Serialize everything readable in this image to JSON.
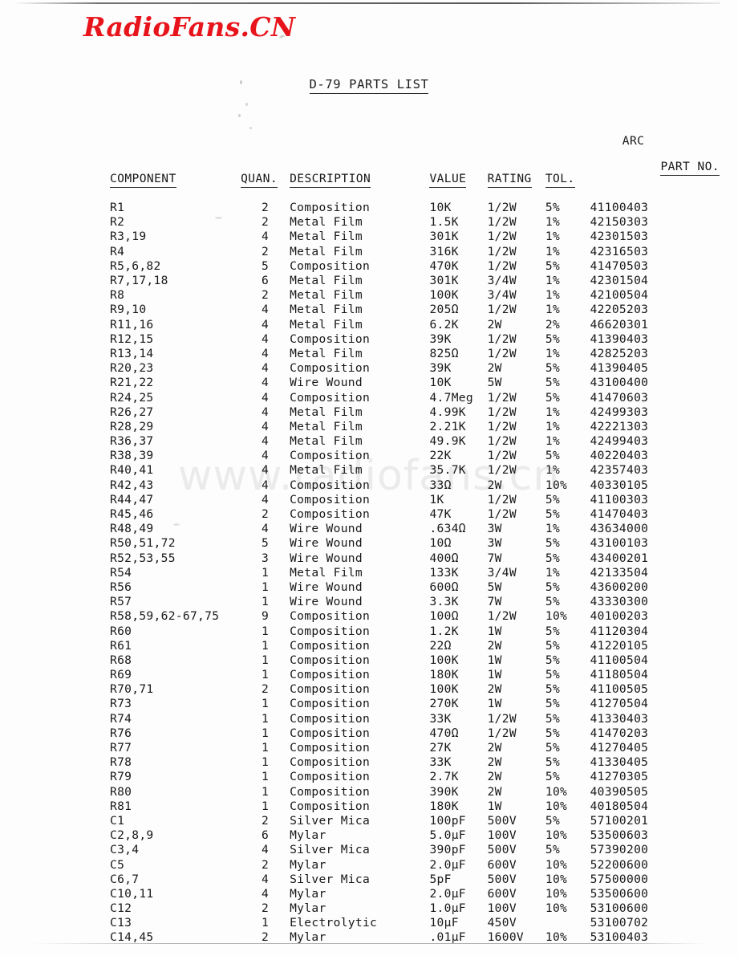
{
  "page": {
    "brand_watermark": "RadioFans.CN",
    "url_watermark": "www.radiofans.cn",
    "title": "D-79 PARTS LIST"
  },
  "table": {
    "headers": {
      "component": "COMPONENT",
      "quan": "QUAN.",
      "description": "DESCRIPTION",
      "value": "VALUE",
      "rating": "RATING",
      "tol": "TOL.",
      "part_no_top": "ARC",
      "part_no": "PART NO."
    },
    "rows": [
      {
        "component": "R1",
        "quan": "2",
        "description": "Composition",
        "value": "10K",
        "rating": "1/2W",
        "tol": "5%",
        "part_no": "41100403"
      },
      {
        "component": "R2",
        "quan": "2",
        "description": "Metal Film",
        "value": "1.5K",
        "rating": "1/2W",
        "tol": "1%",
        "part_no": "42150303"
      },
      {
        "component": "R3,19",
        "quan": "4",
        "description": "Metal Film",
        "value": "301K",
        "rating": "1/2W",
        "tol": "1%",
        "part_no": "42301503"
      },
      {
        "component": "R4",
        "quan": "2",
        "description": "Metal Film",
        "value": "316K",
        "rating": "1/2W",
        "tol": "1%",
        "part_no": "42316503"
      },
      {
        "component": "R5,6,82",
        "quan": "5",
        "description": "Composition",
        "value": "470K",
        "rating": "1/2W",
        "tol": "5%",
        "part_no": "41470503"
      },
      {
        "component": "R7,17,18",
        "quan": "6",
        "description": "Metal Film",
        "value": "301K",
        "rating": "3/4W",
        "tol": "1%",
        "part_no": "42301504"
      },
      {
        "component": "R8",
        "quan": "2",
        "description": "Metal Film",
        "value": "100K",
        "rating": "3/4W",
        "tol": "1%",
        "part_no": "42100504"
      },
      {
        "component": "R9,10",
        "quan": "4",
        "description": "Metal Film",
        "value": "205Ω",
        "rating": "1/2W",
        "tol": "1%",
        "part_no": "42205203"
      },
      {
        "component": "R11,16",
        "quan": "4",
        "description": "Metal Film",
        "value": "6.2K",
        "rating": "2W",
        "tol": "2%",
        "part_no": "46620301"
      },
      {
        "component": "R12,15",
        "quan": "4",
        "description": "Composition",
        "value": "39K",
        "rating": "1/2W",
        "tol": "5%",
        "part_no": "41390403"
      },
      {
        "component": "R13,14",
        "quan": "4",
        "description": "Metal Film",
        "value": "825Ω",
        "rating": "1/2W",
        "tol": "1%",
        "part_no": "42825203"
      },
      {
        "component": "R20,23",
        "quan": "4",
        "description": "Composition",
        "value": "39K",
        "rating": "2W",
        "tol": "5%",
        "part_no": "41390405"
      },
      {
        "component": "R21,22",
        "quan": "4",
        "description": "Wire Wound",
        "value": "10K",
        "rating": "5W",
        "tol": "5%",
        "part_no": "43100400"
      },
      {
        "component": "R24,25",
        "quan": "4",
        "description": "Composition",
        "value": "4.7Meg",
        "rating": "1/2W",
        "tol": "5%",
        "part_no": "41470603"
      },
      {
        "component": "R26,27",
        "quan": "4",
        "description": "Metal Film",
        "value": "4.99K",
        "rating": "1/2W",
        "tol": "1%",
        "part_no": "42499303"
      },
      {
        "component": "R28,29",
        "quan": "4",
        "description": "Metal Film",
        "value": "2.21K",
        "rating": "1/2W",
        "tol": "1%",
        "part_no": "42221303"
      },
      {
        "component": "R36,37",
        "quan": "4",
        "description": "Metal Film",
        "value": "49.9K",
        "rating": "1/2W",
        "tol": "1%",
        "part_no": "42499403"
      },
      {
        "component": "R38,39",
        "quan": "4",
        "description": "Composition",
        "value": "22K",
        "rating": "1/2W",
        "tol": "5%",
        "part_no": "40220403"
      },
      {
        "component": "R40,41",
        "quan": "4",
        "description": "Metal Film",
        "value": "35.7K",
        "rating": "1/2W",
        "tol": "1%",
        "part_no": "42357403"
      },
      {
        "component": "R42,43",
        "quan": "4",
        "description": "Composition",
        "value": "33Ω",
        "rating": "2W",
        "tol": "10%",
        "part_no": "40330105"
      },
      {
        "component": "R44,47",
        "quan": "4",
        "description": "Composition",
        "value": "1K",
        "rating": "1/2W",
        "tol": "5%",
        "part_no": "41100303"
      },
      {
        "component": "R45,46",
        "quan": "2",
        "description": "Composition",
        "value": "47K",
        "rating": "1/2W",
        "tol": "5%",
        "part_no": "41470403"
      },
      {
        "component": "R48,49",
        "quan": "4",
        "description": "Wire Wound",
        "value": ".634Ω",
        "rating": "3W",
        "tol": "1%",
        "part_no": "43634000"
      },
      {
        "component": "R50,51,72",
        "quan": "5",
        "description": "Wire Wound",
        "value": "10Ω",
        "rating": "3W",
        "tol": "5%",
        "part_no": "43100103"
      },
      {
        "component": "R52,53,55",
        "quan": "3",
        "description": "Wire Wound",
        "value": "400Ω",
        "rating": "7W",
        "tol": "5%",
        "part_no": "43400201"
      },
      {
        "component": "R54",
        "quan": "1",
        "description": "Metal Film",
        "value": "133K",
        "rating": "3/4W",
        "tol": "1%",
        "part_no": "42133504"
      },
      {
        "component": "R56",
        "quan": "1",
        "description": "Wire Wound",
        "value": "600Ω",
        "rating": "5W",
        "tol": "5%",
        "part_no": "43600200"
      },
      {
        "component": "R57",
        "quan": "1",
        "description": "Wire Wound",
        "value": "3.3K",
        "rating": "7W",
        "tol": "5%",
        "part_no": "43330300"
      },
      {
        "component": "R58,59,62-67,75",
        "quan": "9",
        "description": "Composition",
        "value": "100Ω",
        "rating": "1/2W",
        "tol": "10%",
        "part_no": "40100203"
      },
      {
        "component": "R60",
        "quan": "1",
        "description": "Composition",
        "value": "1.2K",
        "rating": "1W",
        "tol": "5%",
        "part_no": "41120304"
      },
      {
        "component": "R61",
        "quan": "1",
        "description": "Composition",
        "value": "22Ω",
        "rating": "2W",
        "tol": "5%",
        "part_no": "41220105"
      },
      {
        "component": "R68",
        "quan": "1",
        "description": "Composition",
        "value": "100K",
        "rating": "1W",
        "tol": "5%",
        "part_no": "41100504"
      },
      {
        "component": "R69",
        "quan": "1",
        "description": "Composition",
        "value": "180K",
        "rating": "1W",
        "tol": "5%",
        "part_no": "41180504"
      },
      {
        "component": "R70,71",
        "quan": "2",
        "description": "Composition",
        "value": "100K",
        "rating": "2W",
        "tol": "5%",
        "part_no": "41100505"
      },
      {
        "component": "R73",
        "quan": "1",
        "description": "Composition",
        "value": "270K",
        "rating": "1W",
        "tol": "5%",
        "part_no": "41270504"
      },
      {
        "component": "R74",
        "quan": "1",
        "description": "Composition",
        "value": "33K",
        "rating": "1/2W",
        "tol": "5%",
        "part_no": "41330403"
      },
      {
        "component": "R76",
        "quan": "1",
        "description": "Composition",
        "value": "470Ω",
        "rating": "1/2W",
        "tol": "5%",
        "part_no": "41470203"
      },
      {
        "component": "R77",
        "quan": "1",
        "description": "Composition",
        "value": "27K",
        "rating": "2W",
        "tol": "5%",
        "part_no": "41270405"
      },
      {
        "component": "R78",
        "quan": "1",
        "description": "Composition",
        "value": "33K",
        "rating": "2W",
        "tol": "5%",
        "part_no": "41330405"
      },
      {
        "component": "R79",
        "quan": "1",
        "description": "Composition",
        "value": "2.7K",
        "rating": "2W",
        "tol": "5%",
        "part_no": "41270305"
      },
      {
        "component": "R80",
        "quan": "1",
        "description": "Composition",
        "value": "390K",
        "rating": "2W",
        "tol": "10%",
        "part_no": "40390505"
      },
      {
        "component": "R81",
        "quan": "1",
        "description": "Composition",
        "value": "180K",
        "rating": "1W",
        "tol": "10%",
        "part_no": "40180504"
      },
      {
        "component": "C1",
        "quan": "2",
        "description": "Silver Mica",
        "value": "100pF",
        "rating": "500V",
        "tol": "5%",
        "part_no": "57100201"
      },
      {
        "component": "C2,8,9",
        "quan": "6",
        "description": "Mylar",
        "value": "5.0µF",
        "rating": "100V",
        "tol": "10%",
        "part_no": "53500603"
      },
      {
        "component": "C3,4",
        "quan": "4",
        "description": "Silver Mica",
        "value": "390pF",
        "rating": "500V",
        "tol": "5%",
        "part_no": "57390200"
      },
      {
        "component": "C5",
        "quan": "2",
        "description": "Mylar",
        "value": "2.0µF",
        "rating": "600V",
        "tol": "10%",
        "part_no": "52200600"
      },
      {
        "component": "C6,7",
        "quan": "4",
        "description": "Silver Mica",
        "value": "5pF",
        "rating": "500V",
        "tol": "10%",
        "part_no": "57500000"
      },
      {
        "component": "C10,11",
        "quan": "4",
        "description": "Mylar",
        "value": "2.0µF",
        "rating": "600V",
        "tol": "10%",
        "part_no": "53500600"
      },
      {
        "component": "C12",
        "quan": "2",
        "description": "Mylar",
        "value": "1.0µF",
        "rating": "100V",
        "tol": "10%",
        "part_no": "53100600"
      },
      {
        "component": "C13",
        "quan": "1",
        "description": "Electrolytic",
        "value": "10µF",
        "rating": "450V",
        "tol": "",
        "part_no": "53100702"
      },
      {
        "component": "C14,45",
        "quan": "2",
        "description": "Mylar",
        "value": ".01µF",
        "rating": "1600V",
        "tol": "10%",
        "part_no": "53100403"
      }
    ]
  }
}
